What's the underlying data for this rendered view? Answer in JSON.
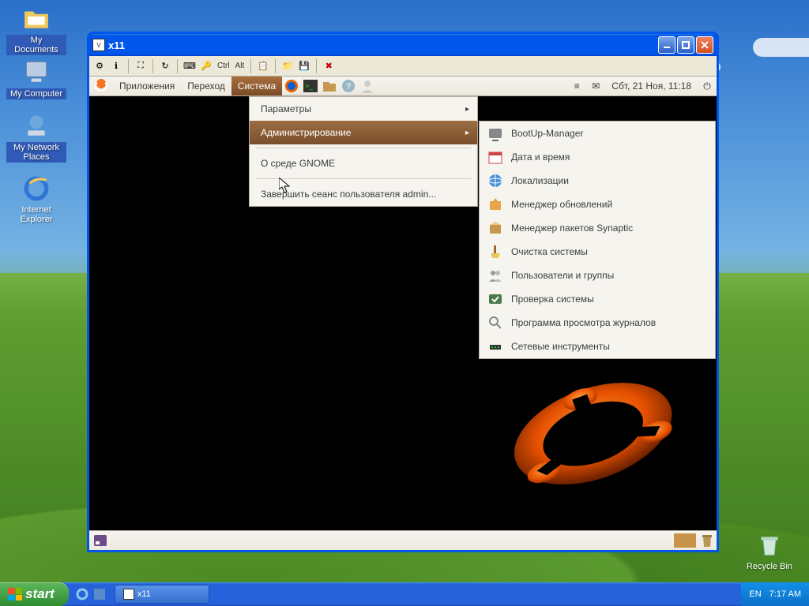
{
  "desktop_icons": {
    "my_documents": "My Documents",
    "my_computer": "My Computer",
    "my_network_places": "My Network Places",
    "internet_explorer": "Internet Explorer",
    "recycle_bin": "Recycle Bin"
  },
  "window": {
    "title": "x11",
    "vnc_keys": {
      "ctrl": "Ctrl",
      "alt": "Alt"
    }
  },
  "gnome": {
    "menus": {
      "applications": "Приложения",
      "places": "Переход",
      "system": "Система"
    },
    "datetime": "Сбт, 21 Ноя, 11:18",
    "system_menu": {
      "preferences": "Параметры",
      "administration": "Администрирование",
      "about_gnome": "О среде GNOME",
      "logout": "Завершить сеанс пользователя admin..."
    },
    "admin_submenu": {
      "bootup_manager": "BootUp-Manager",
      "date_time": "Дата и время",
      "localizations": "Локализации",
      "update_manager": "Менеджер обновлений",
      "synaptic": "Менеджер пакетов Synaptic",
      "system_cleanup": "Очистка системы",
      "users_groups": "Пользователи и группы",
      "system_testing": "Проверка системы",
      "log_viewer": "Программа просмотра журналов",
      "network_tools": "Сетевые инструменты"
    }
  },
  "taskbar": {
    "start": "start",
    "task_x11": "x11",
    "lang": "EN",
    "time": "7:17 AM"
  }
}
